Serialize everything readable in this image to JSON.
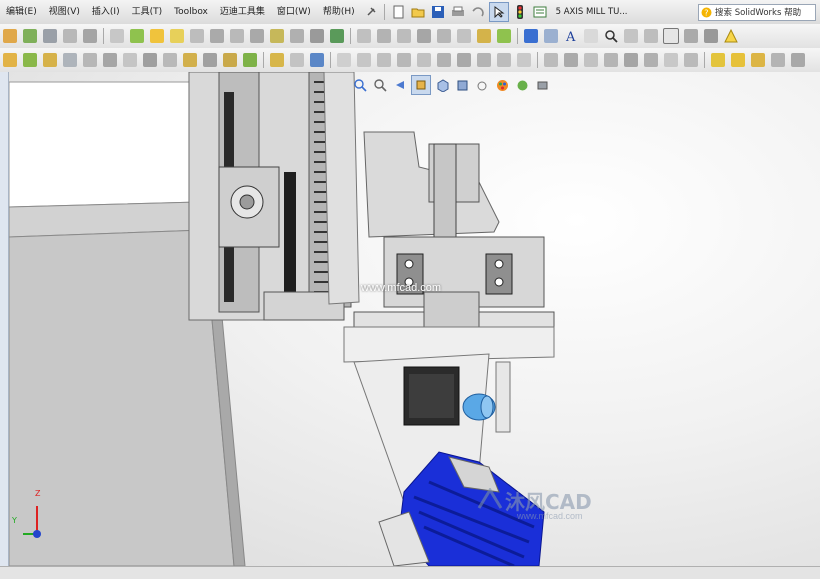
{
  "menubar": {
    "items": [
      "编辑(E)",
      "视图(V)",
      "插入(I)",
      "工具(T)",
      "Toolbox",
      "迈迪工具集",
      "窗口(W)",
      "帮助(H)"
    ],
    "document_title": "5 AXIS MILL TU...",
    "search_placeholder": "搜索 SolidWorks 帮助"
  },
  "viewport": {
    "watermark_url": "www.mfcad.com",
    "logo_text": "沐风CAD",
    "logo_url": "www.mfcad.com",
    "triad_axes": [
      "Y",
      "Z"
    ]
  },
  "colors": {
    "motor_blue": "#1a2fd8",
    "coupling_cyan": "#5aa8e6",
    "part_gray": "#c9c9c9",
    "viewport_bg": "#f1f1f1"
  }
}
